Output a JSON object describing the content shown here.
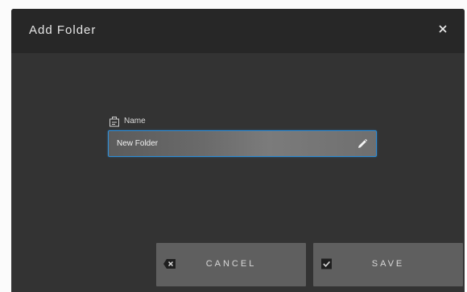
{
  "dialog": {
    "title": "Add Folder",
    "close_icon": "close-icon"
  },
  "name_field": {
    "label": "Name",
    "label_icon": "folder-tag-icon",
    "value": "New Folder",
    "edit_icon": "pencil-icon"
  },
  "buttons": {
    "cancel": {
      "label": "CANCEL",
      "icon": "backspace-x-icon"
    },
    "save": {
      "label": "SAVE",
      "icon": "checkbox-checked-icon"
    }
  },
  "colors": {
    "dialog_bg": "#333333",
    "header_bg": "#272727",
    "input_border": "#2f8fd8",
    "button_bg": "#5f5f5f"
  }
}
